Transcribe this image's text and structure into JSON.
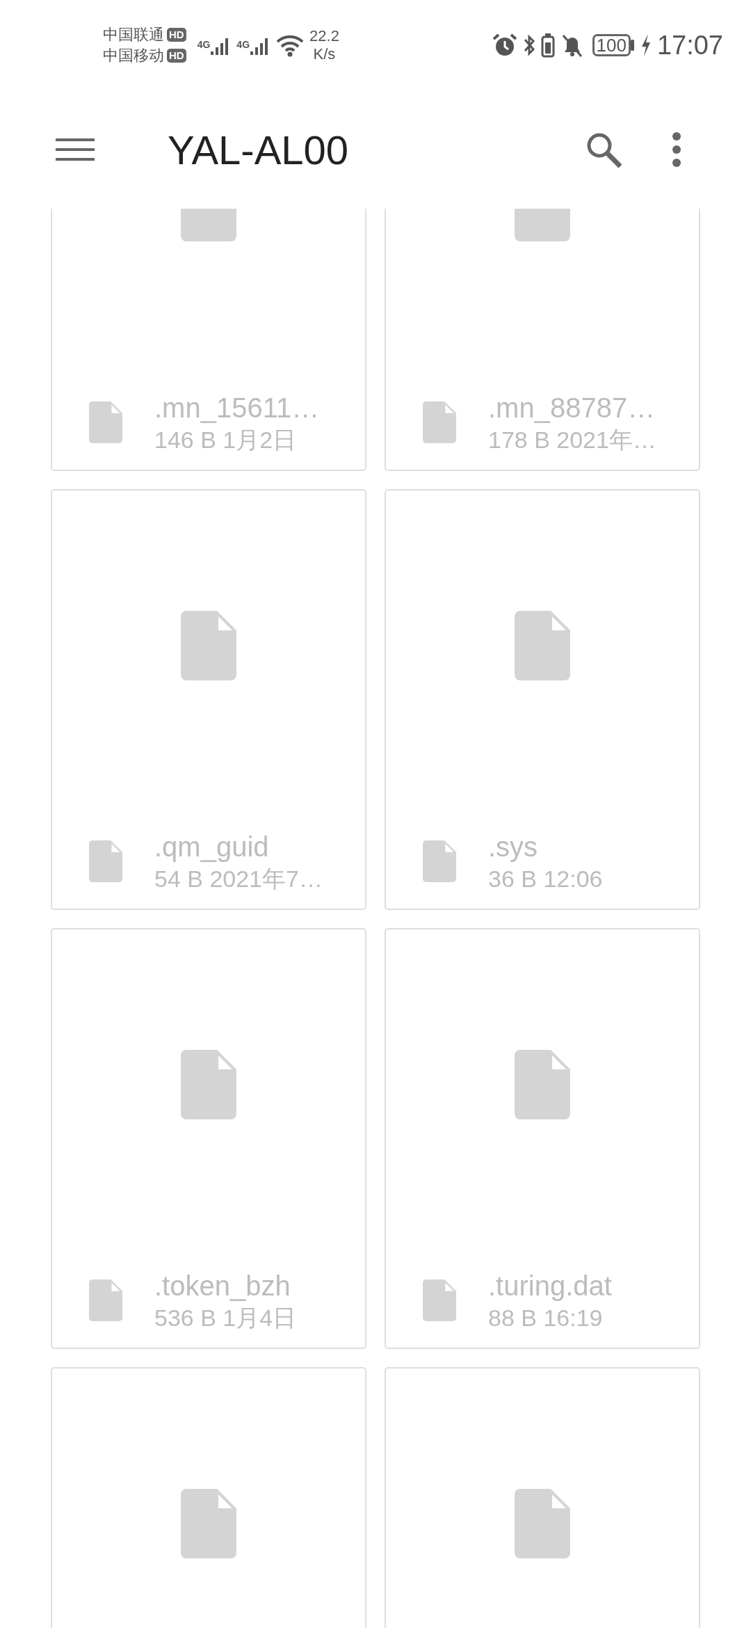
{
  "status_bar": {
    "carriers": [
      {
        "name": "中国联通",
        "badge": "HD"
      },
      {
        "name": "中国移动",
        "badge": "HD"
      }
    ],
    "signals": [
      {
        "label": "4G"
      },
      {
        "label": "4G"
      }
    ],
    "speed": {
      "value": "22.2",
      "unit": "K/s"
    },
    "battery": "100",
    "time": "17:07"
  },
  "app_bar": {
    "title": "YAL-AL00"
  },
  "files": [
    {
      "kind": "file",
      "name": ".mn_15611…",
      "meta": "146 B 1月2日"
    },
    {
      "kind": "file",
      "name": ".mn_88787…",
      "meta": "178 B 2021年…"
    },
    {
      "kind": "file",
      "name": ".qm_guid",
      "meta": "54 B 2021年7…"
    },
    {
      "kind": "file",
      "name": ".sys",
      "meta": "36 B 12:06"
    },
    {
      "kind": "file",
      "name": ".token_bzh",
      "meta": "536 B 1月4日"
    },
    {
      "kind": "file",
      "name": ".turing.dat",
      "meta": "88 B 16:19"
    },
    {
      "kind": "file"
    },
    {
      "kind": "file"
    }
  ]
}
